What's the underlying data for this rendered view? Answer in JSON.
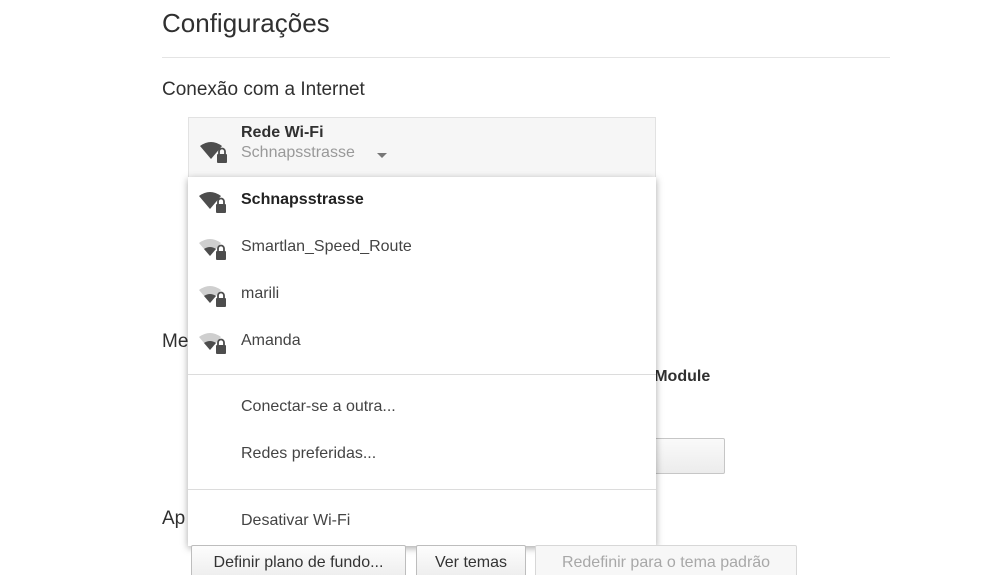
{
  "page": {
    "title": "Configurações"
  },
  "sections": {
    "internet": "Conexão com a Internet",
    "partial_me": "Me",
    "partial_ap": "Ap"
  },
  "background": {
    "partial_bold": "n Module"
  },
  "network_card": {
    "title": "Rede Wi-Fi",
    "current": "Schnapsstrasse",
    "icon": "wifi-lock-icon"
  },
  "dropdown": {
    "networks": [
      {
        "name": "Schnapsstrasse",
        "selected": true
      },
      {
        "name": "Smartlan_Speed_Route",
        "selected": false
      },
      {
        "name": "marili",
        "selected": false
      },
      {
        "name": "Amanda",
        "selected": false
      }
    ],
    "actions": {
      "connect_other": "Conectar-se a outra...",
      "preferred": "Redes preferidas...",
      "disable": "Desativar Wi-Fi"
    }
  },
  "buttons": {
    "set_background": "Definir plano de fundo...",
    "view_themes": "Ver temas",
    "reset_theme": "Redefinir para o tema padrão"
  },
  "colors": {
    "accent_text": "#303030",
    "disabled_text": "#a8a8a8"
  }
}
